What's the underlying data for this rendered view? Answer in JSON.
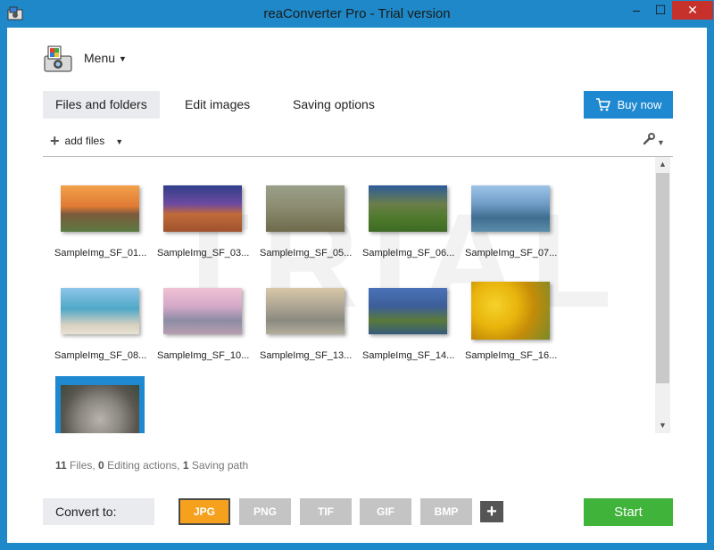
{
  "window": {
    "title": "reaConverter Pro - Trial version",
    "minimize": "‒",
    "maximize": "☐",
    "close": "✕"
  },
  "menu": {
    "label": "Menu"
  },
  "tabs": [
    {
      "label": "Files and folders",
      "active": true
    },
    {
      "label": "Edit images",
      "active": false
    },
    {
      "label": "Saving options",
      "active": false
    }
  ],
  "buy_button": {
    "label": "Buy now",
    "color": "#1e88d0"
  },
  "toolbar": {
    "add_files_label": "add files"
  },
  "watermark": "TRIAL",
  "files": [
    {
      "name": "SampleImg_SF_01...",
      "icon": "sunset-landscape"
    },
    {
      "name": "SampleImg_SF_03...",
      "icon": "lighthouse"
    },
    {
      "name": "SampleImg_SF_05...",
      "icon": "elephant"
    },
    {
      "name": "SampleImg_SF_06...",
      "icon": "mountain-valley"
    },
    {
      "name": "SampleImg_SF_07...",
      "icon": "coastline"
    },
    {
      "name": "SampleImg_SF_08...",
      "icon": "beach"
    },
    {
      "name": "SampleImg_SF_10...",
      "icon": "stone-pillars"
    },
    {
      "name": "SampleImg_SF_13...",
      "icon": "misty-lake"
    },
    {
      "name": "SampleImg_SF_14...",
      "icon": "sea-cliff"
    },
    {
      "name": "SampleImg_SF_16...",
      "icon": "yellow-tulips"
    }
  ],
  "selected_file": {
    "icon": "koala",
    "selected": true
  },
  "status": {
    "files_count": "11",
    "files_label": "Files,",
    "actions_count": "0",
    "actions_label": "Editing actions,",
    "paths_count": "1",
    "paths_label": "Saving path"
  },
  "convert": {
    "label": "Convert to:",
    "formats": [
      {
        "label": "JPG",
        "active": true
      },
      {
        "label": "PNG",
        "active": false
      },
      {
        "label": "TIF",
        "active": false
      },
      {
        "label": "GIF",
        "active": false
      },
      {
        "label": "BMP",
        "active": false
      }
    ],
    "add_label": "+"
  },
  "start_button": {
    "label": "Start",
    "color": "#3fb33a"
  },
  "colors": {
    "accent": "#1e88d0",
    "active_format": "#f5a11e",
    "window_frame": "#1e88c8"
  }
}
